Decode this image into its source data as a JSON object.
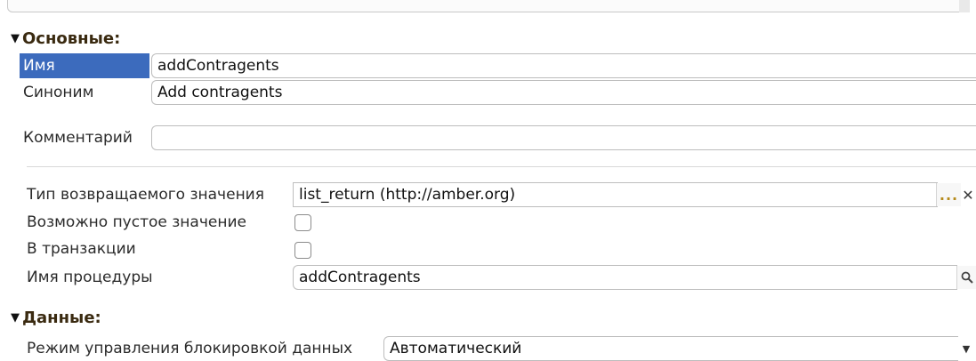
{
  "sections": {
    "main": {
      "title": "Основные:"
    },
    "data": {
      "title": "Данные:"
    }
  },
  "fields": {
    "name": {
      "label": "Имя",
      "value": "addContragents"
    },
    "synonym": {
      "label": "Синоним",
      "value": "Add contragents"
    },
    "comment": {
      "label": "Комментарий",
      "value": ""
    },
    "return_type": {
      "label": "Тип возвращаемого значения",
      "value": "list_return (http://amber.org)",
      "select_button": "...",
      "clear_button": "✕"
    },
    "nullable": {
      "label": "Возможно пустое значение",
      "checked": false
    },
    "in_transaction": {
      "label": "В транзакции",
      "checked": false
    },
    "procedure_name": {
      "label": "Имя процедуры",
      "value": "addContragents"
    },
    "lock_mode": {
      "label": "Режим управления блокировкой данных",
      "value": "Автоматический"
    }
  },
  "icons": {
    "collapse": "triangle-down-icon",
    "search": "magnifier-icon",
    "dropdown": "chevron-down-icon"
  },
  "colors": {
    "selection": "#3c6bbd",
    "section_title": "#3a2a10",
    "ellipsis_button": "#b58a1b"
  }
}
